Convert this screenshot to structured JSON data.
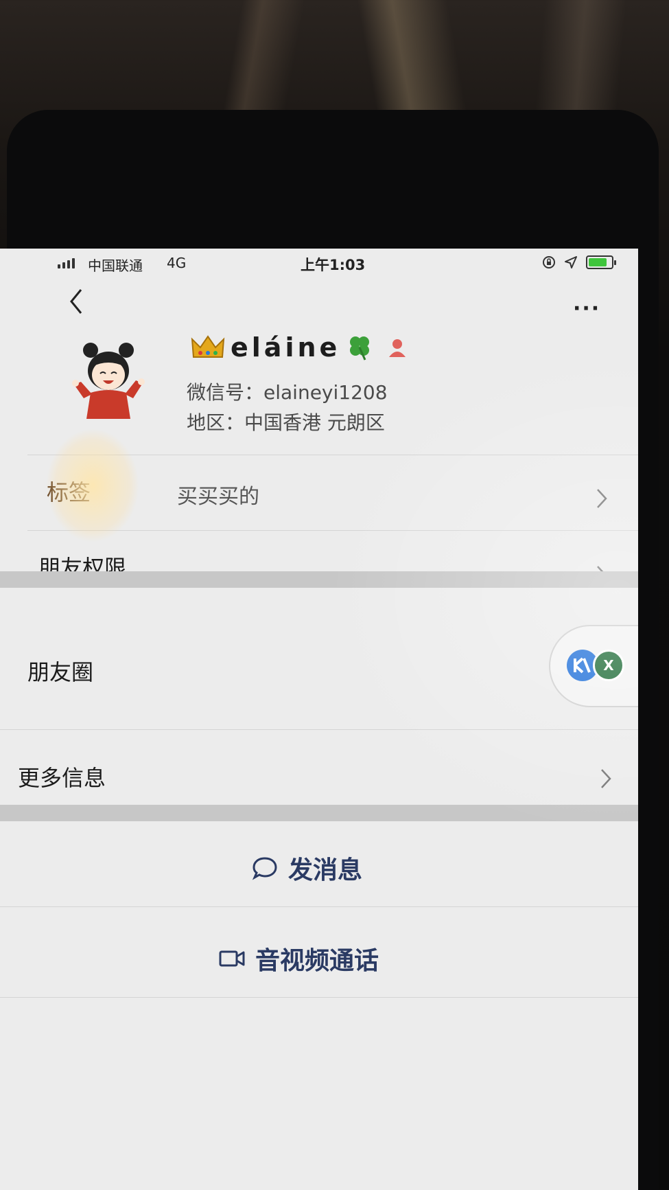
{
  "status_bar": {
    "carrier": "中国联通",
    "network": "4G",
    "time": "上午1:03"
  },
  "profile": {
    "nickname": "eláine",
    "wechat_id": "微信号：elaineyi1208",
    "region": "地区：中国香港 元朗区"
  },
  "rows": {
    "tags_label": "标签",
    "tags_value": "买买买的",
    "permissions_label": "朋友权限",
    "moments_label": "朋友圈",
    "more_info_label": "更多信息"
  },
  "moments_thumbs": {
    "b_text": "X"
  },
  "actions": {
    "message": "发消息",
    "call": "音视频通话"
  },
  "colors": {
    "action_text": "#2a3a63",
    "battery": "#3fc53c"
  }
}
